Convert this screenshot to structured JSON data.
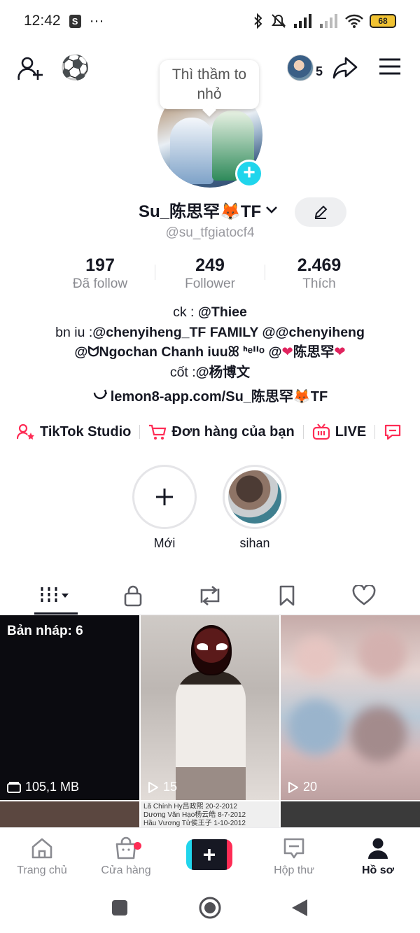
{
  "status_bar": {
    "time": "12:42",
    "more": "···",
    "battery": "68"
  },
  "top_nav": {
    "viewers_count": "5"
  },
  "tooltip": {
    "text": "Thì thầm to nhỏ"
  },
  "profile": {
    "name": "Su_陈思罕🦊TF",
    "handle": "@su_tfgiatocf4"
  },
  "stats": {
    "following": {
      "value": "197",
      "label": "Đã follow"
    },
    "followers": {
      "value": "249",
      "label": "Follower"
    },
    "likes": {
      "value": "2.469",
      "label": "Thích"
    }
  },
  "bio": {
    "line1_prefix": "ck : ",
    "line1_mention": "@Thiee",
    "line2_prefix": "bn iu :",
    "line2_mentions": "@chenyiheng_TF FAMILY @@chenyiheng",
    "line3_a": "@ᗢNgochan Chanh iuuꕤ ᑋᵉᑊᑊᵒ @",
    "line3_b": "陈思罕",
    "line4_prefix": "cốt :",
    "line4_mention": "@杨博文",
    "link": "lemon8-app.com/Su_陈思罕🦊TF"
  },
  "shortcuts": [
    {
      "label": "TikTok Studio",
      "icon": "person-star-icon"
    },
    {
      "label": "Đơn hàng của bạn",
      "icon": "cart-icon"
    },
    {
      "label": "LIVE",
      "icon": "tv-icon"
    }
  ],
  "highlights": [
    {
      "label": "Mới"
    },
    {
      "label": "sihan"
    }
  ],
  "tabs": [
    "videos-grid",
    "private",
    "reposts",
    "favorites",
    "liked"
  ],
  "grid": {
    "drafts_label": "Bản nháp: 6",
    "drafts_size": "105,1 MB",
    "video2_views": "15",
    "video3_views": "20",
    "cell5_text": [
      "Lã Chính Hy吕政熙 20-2-2012",
      "Dương Văn Hạo杨云皓 8-7-2012",
      "Hầu Vương Tử侯王子 1-10-2012"
    ]
  },
  "bottom_nav": {
    "home": "Trang chủ",
    "shop": "Cửa hàng",
    "inbox": "Hộp thư",
    "profile": "Hồ sơ"
  },
  "colors": {
    "accent": "#fe2c55",
    "cyan": "#20d5ec",
    "text": "#161823",
    "muted": "#8a8b91"
  }
}
